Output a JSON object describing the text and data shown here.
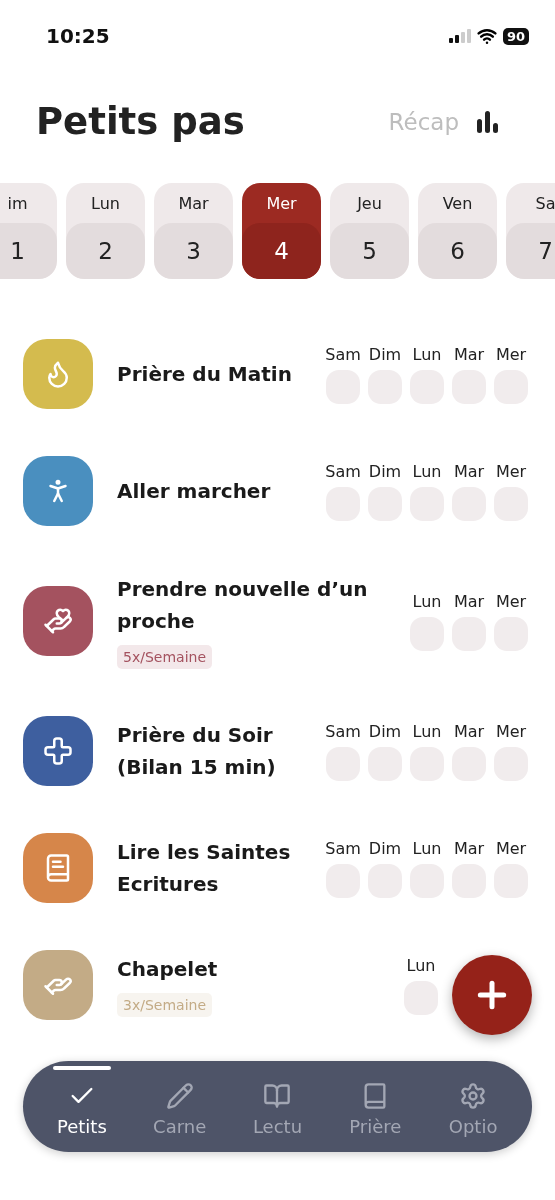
{
  "status_bar": {
    "time": "10:25",
    "battery": "90"
  },
  "header": {
    "title": "Petits pas",
    "recap": "Récap"
  },
  "days": [
    {
      "weekday": "im",
      "date": "1",
      "selected": false
    },
    {
      "weekday": "Lun",
      "date": "2",
      "selected": false
    },
    {
      "weekday": "Mar",
      "date": "3",
      "selected": false
    },
    {
      "weekday": "Mer",
      "date": "4",
      "selected": true
    },
    {
      "weekday": "Jeu",
      "date": "5",
      "selected": false
    },
    {
      "weekday": "Ven",
      "date": "6",
      "selected": false
    },
    {
      "weekday": "Sa",
      "date": "7",
      "selected": false
    }
  ],
  "habits": [
    {
      "title": "Prière du Matin",
      "kind": "flame",
      "color": "#d4bb4e",
      "days": [
        "Sam",
        "Dim",
        "Lun",
        "Mar",
        "Mer"
      ]
    },
    {
      "title": "Aller marcher",
      "kind": "walk",
      "color": "#4a8fbf",
      "days": [
        "Sam",
        "Dim",
        "Lun",
        "Mar",
        "Mer"
      ]
    },
    {
      "title": "Prendre nouvelle d’un proche",
      "kind": "care",
      "color": "#a4525f",
      "badge": "5x/Semaine",
      "days": [
        "Lun",
        "Mar",
        "Mer"
      ]
    },
    {
      "title": "Prière du Soir (Bilan 15 min)",
      "kind": "cross",
      "color": "#3e5f9f",
      "days": [
        "Sam",
        "Dim",
        "Lun",
        "Mar",
        "Mer"
      ]
    },
    {
      "title": "Lire les Saintes Ecritures",
      "kind": "bible",
      "color": "#d6864a",
      "days": [
        "Sam",
        "Dim",
        "Lun",
        "Mar",
        "Mer"
      ]
    },
    {
      "title": "Chapelet",
      "kind": "hands",
      "color": "#c3ab86",
      "badge": "3x/Semaine",
      "days": [
        "Lun"
      ]
    }
  ],
  "nav": [
    {
      "label": "Petits",
      "kind": "check",
      "selected": true
    },
    {
      "label": "Carne",
      "kind": "pencil",
      "selected": false
    },
    {
      "label": "Lectu",
      "kind": "book-open",
      "selected": false
    },
    {
      "label": "Prière",
      "kind": "book",
      "selected": false
    },
    {
      "label": "Optio",
      "kind": "gear",
      "selected": false
    }
  ]
}
